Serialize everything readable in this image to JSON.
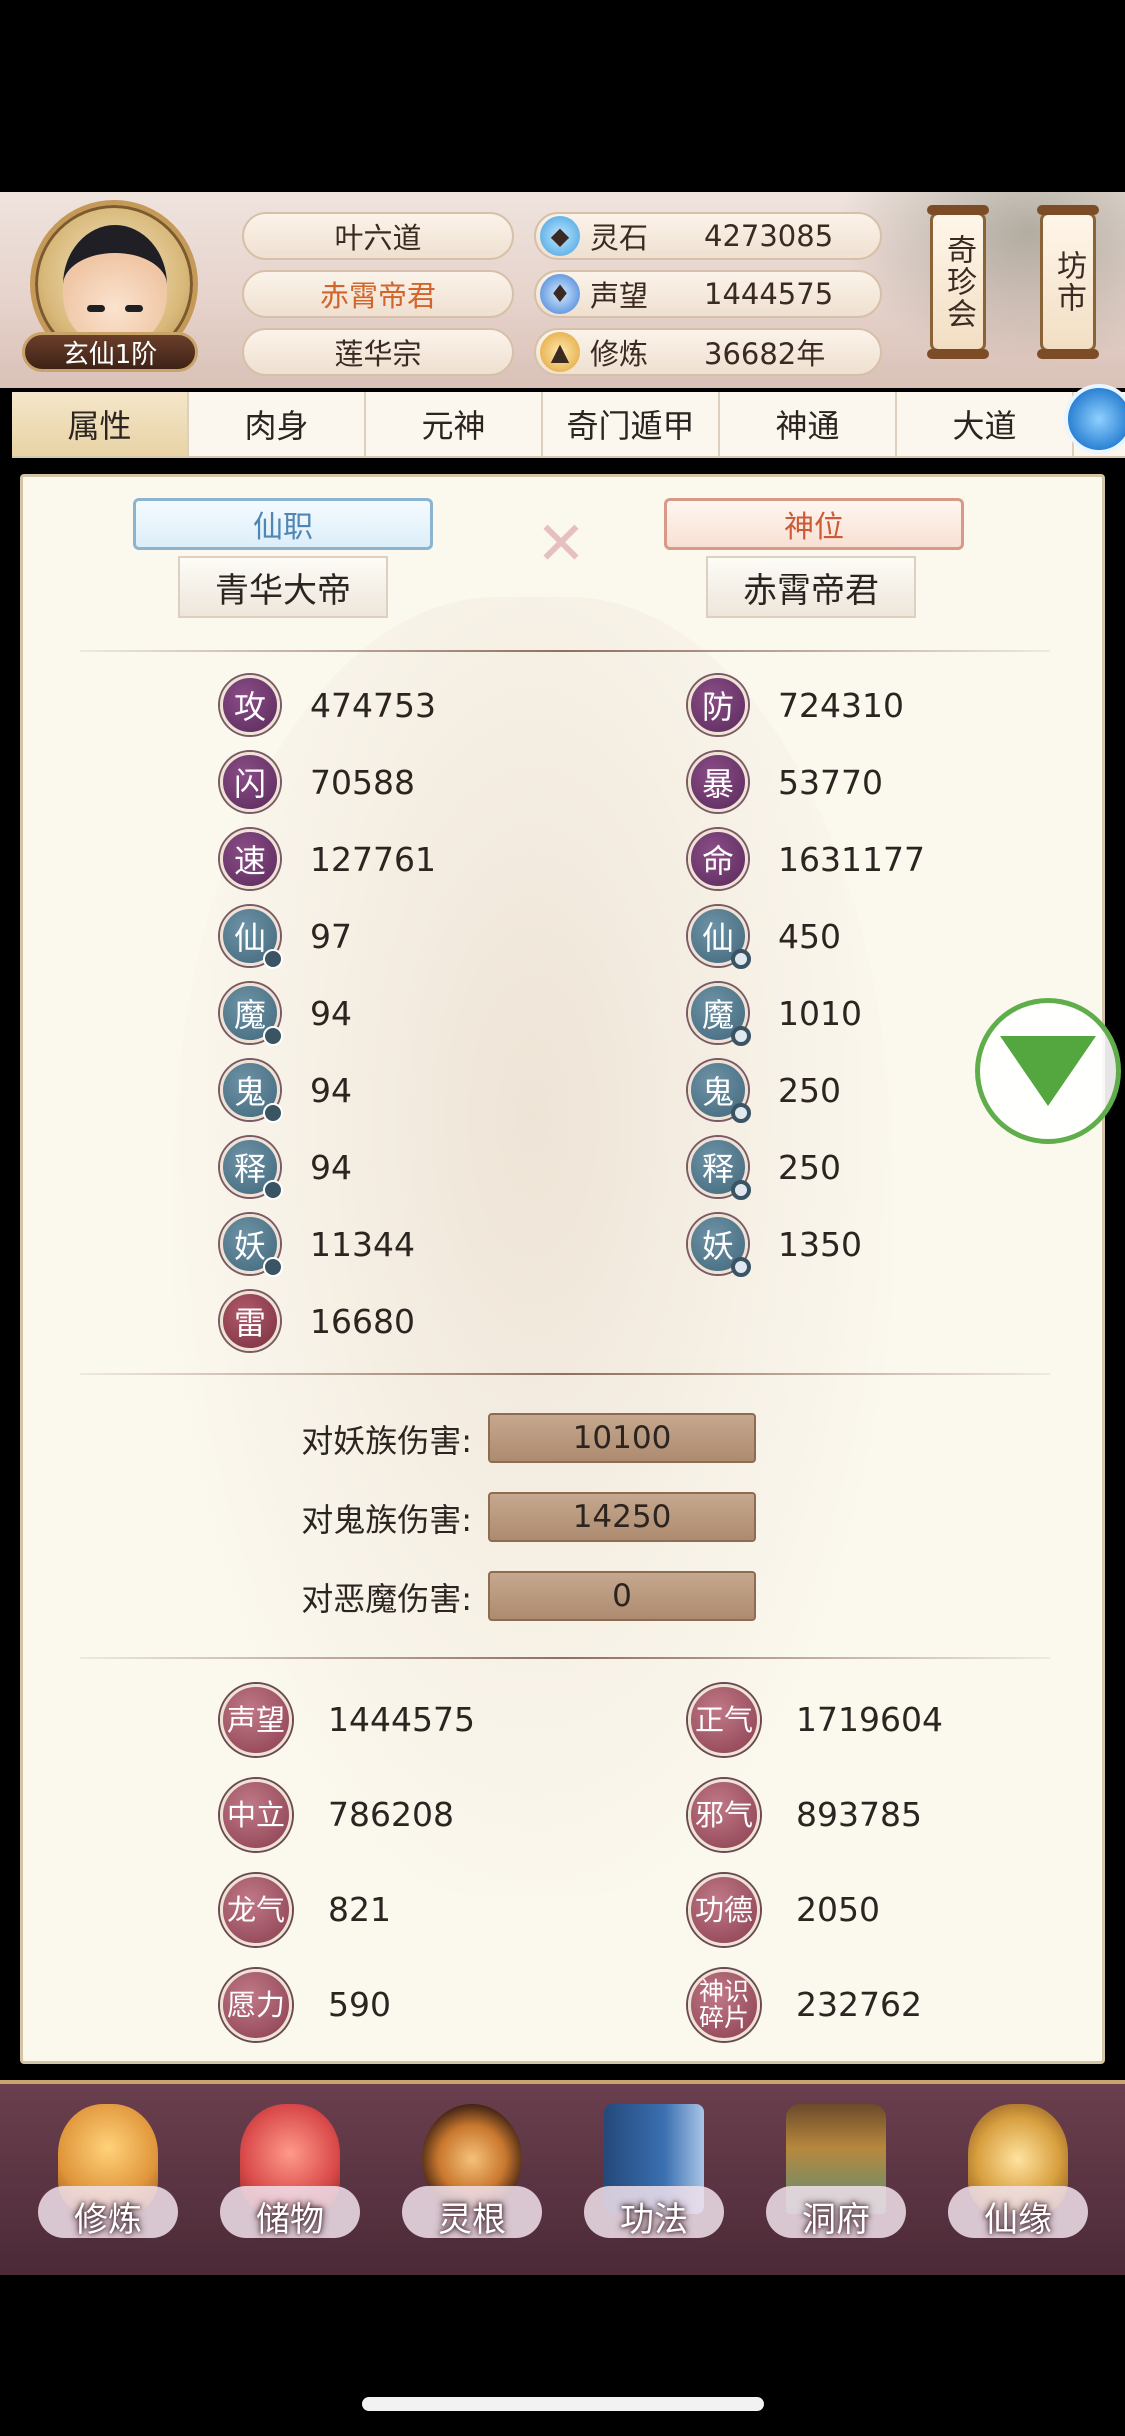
{
  "player": {
    "rank_badge": "玄仙1阶",
    "name": "叶六道",
    "title": "赤霄帝君",
    "sect": "莲华宗"
  },
  "resources": [
    {
      "name": "灵石",
      "value": "4273085",
      "icon": "spirit-stone-icon",
      "color": "#3fa0e0"
    },
    {
      "name": "声望",
      "value": "1444575",
      "icon": "prestige-drop-icon",
      "color": "#3a7bd5"
    },
    {
      "name": "修炼",
      "value": "36682年",
      "icon": "meditation-icon",
      "color": "#e0a030"
    }
  ],
  "side_buttons": [
    {
      "label": "奇珍会"
    },
    {
      "label": "坊市"
    }
  ],
  "tabs": [
    "属性",
    "肉身",
    "元神",
    "奇门遁甲",
    "神通",
    "大道"
  ],
  "titles": {
    "xianzhi_label": "仙职",
    "xianzhi_value": "青华大帝",
    "shenwei_label": "神位",
    "shenwei_value": "赤霄帝君"
  },
  "stats_left": [
    {
      "icon": "攻",
      "value": "474753",
      "style": "purple"
    },
    {
      "icon": "闪",
      "value": "70588",
      "style": "purple"
    },
    {
      "icon": "速",
      "value": "127761",
      "style": "purple"
    },
    {
      "icon": "仙",
      "value": "97",
      "style": "teal"
    },
    {
      "icon": "魔",
      "value": "94",
      "style": "teal"
    },
    {
      "icon": "鬼",
      "value": "94",
      "style": "teal"
    },
    {
      "icon": "释",
      "value": "94",
      "style": "teal"
    },
    {
      "icon": "妖",
      "value": "11344",
      "style": "teal"
    },
    {
      "icon": "雷",
      "value": "16680",
      "style": "crimson"
    }
  ],
  "stats_right": [
    {
      "icon": "防",
      "value": "724310",
      "style": "purple"
    },
    {
      "icon": "暴",
      "value": "53770",
      "style": "purple"
    },
    {
      "icon": "命",
      "value": "1631177",
      "style": "purple"
    },
    {
      "icon": "仙",
      "value": "450",
      "style": "teal"
    },
    {
      "icon": "魔",
      "value": "1010",
      "style": "teal"
    },
    {
      "icon": "鬼",
      "value": "250",
      "style": "teal"
    },
    {
      "icon": "释",
      "value": "250",
      "style": "teal"
    },
    {
      "icon": "妖",
      "value": "1350",
      "style": "teal"
    }
  ],
  "damage": [
    {
      "label": "对妖族伤害:",
      "value": "10100"
    },
    {
      "label": "对鬼族伤害:",
      "value": "14250"
    },
    {
      "label": "对恶魔伤害:",
      "value": "0"
    }
  ],
  "misc_left": [
    {
      "icon": "声望",
      "value": "1444575"
    },
    {
      "icon": "中立",
      "value": "786208"
    },
    {
      "icon": "龙气",
      "value": "821"
    },
    {
      "icon": "愿力",
      "value": "590"
    }
  ],
  "misc_right": [
    {
      "icon": "正气",
      "value": "1719604"
    },
    {
      "icon": "邪气",
      "value": "893785"
    },
    {
      "icon": "功德",
      "value": "2050"
    },
    {
      "icon": "神识碎片",
      "value": "232762"
    }
  ],
  "bottom_nav": [
    {
      "label": "修炼",
      "icon": "cultivate-monk-icon",
      "color": "#e0953a"
    },
    {
      "label": "储物",
      "icon": "storage-bag-icon",
      "color": "#d94a4a"
    },
    {
      "label": "灵根",
      "icon": "spirit-root-icon",
      "color": "#c9782e"
    },
    {
      "label": "功法",
      "icon": "technique-book-icon",
      "color": "#3a6fb0"
    },
    {
      "label": "洞府",
      "icon": "cave-mansion-icon",
      "color": "#b7883d"
    },
    {
      "label": "仙缘",
      "icon": "immortal-fate-icon",
      "color": "#d8a040"
    }
  ]
}
